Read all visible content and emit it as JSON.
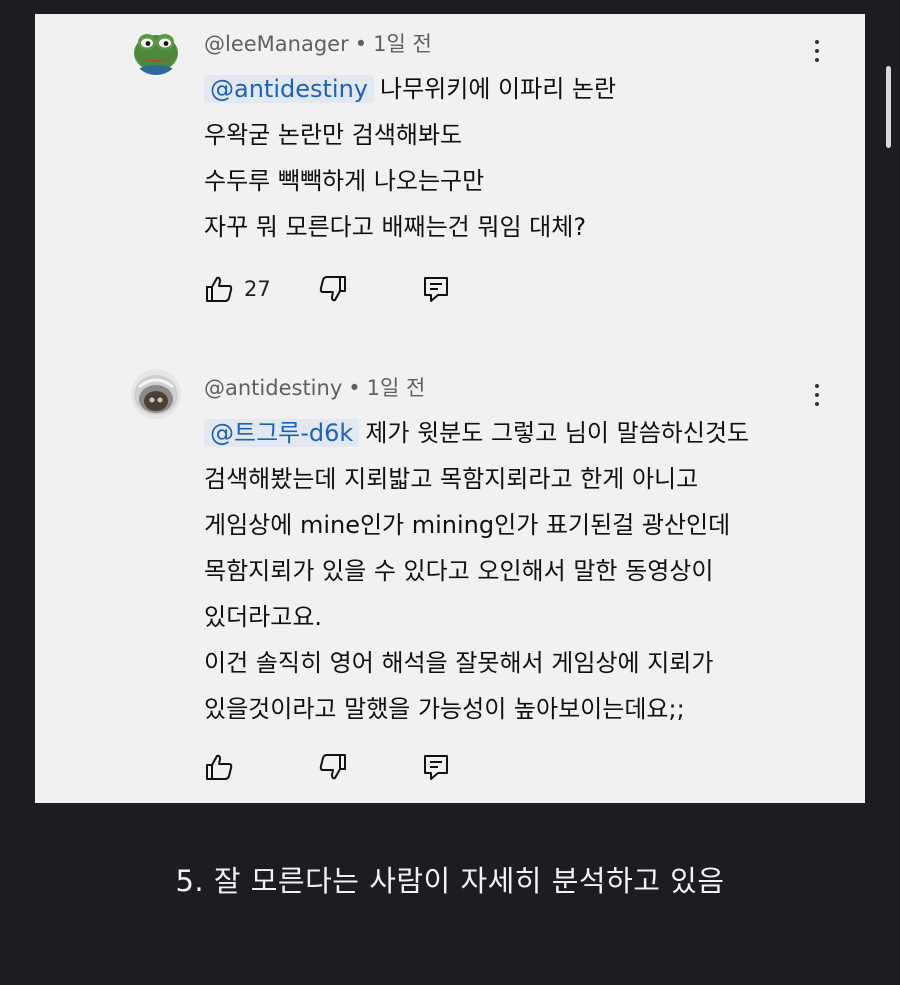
{
  "comments": [
    {
      "author": "@leeManager",
      "time": "1일 전",
      "separator": "•",
      "mention": "@antidestiny",
      "lines": [
        "나무위키에 이파리 논란",
        "우왁굳 논란만 검색해봐도",
        "수두루 빽빽하게 나오는구만",
        "자꾸 뭐 모른다고 배째는건 뭐임 대체?"
      ],
      "likes": "27",
      "avatar_icon": "pepe-frog-avatar"
    },
    {
      "author": "@antidestiny",
      "time": "1일 전",
      "separator": "•",
      "mention": "@트그루-d6k",
      "lines": [
        "제가 윗분도 그렇고 님이 말씀하신것도",
        "검색해봤는데 지뢰밟고 목함지뢰라고 한게 아니고",
        "게임상에 mine인가 mining인가 표기된걸 광산인데",
        "목함지뢰가 있을 수 있다고 오인해서 말한 동영상이",
        "있더라고요.",
        "이건 솔직히 영어 해석을 잘못해서 게임상에 지뢰가",
        "있을것이라고 말했을 가능성이 높아보이는데요;;"
      ],
      "likes": "",
      "avatar_icon": "helmet-photo-avatar"
    }
  ],
  "caption": "5. 잘 모른다는 사람이 자세히 분석하고 있음",
  "colors": {
    "background": "#1c1d20",
    "card": "#f1f1f1",
    "mention": "#1c62b9",
    "meta": "#606060"
  }
}
